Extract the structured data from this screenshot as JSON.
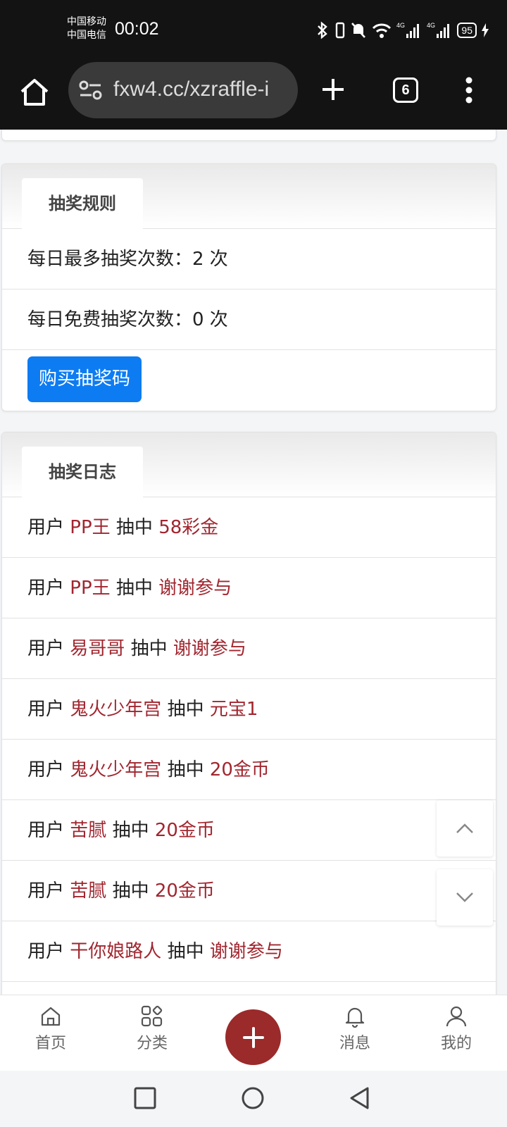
{
  "status_bar": {
    "carrier_1": "中国移动",
    "carrier_2": "中国电信",
    "time": "00:02",
    "network_1": "4G",
    "network_2": "4G",
    "battery": "95"
  },
  "browser": {
    "url": "fxw4.cc/xzraffle-i",
    "tab_count": "6"
  },
  "rules_card": {
    "title": "抽奖规则",
    "max_daily": "每日最多抽奖次数：2 次",
    "free_daily": "每日免费抽奖次数：0 次",
    "buy_button": "购买抽奖码"
  },
  "log_card": {
    "title": "抽奖日志",
    "prefix": "用户",
    "verb": "抽中",
    "entries": [
      {
        "user": "PP王",
        "prize": "58彩金"
      },
      {
        "user": "PP王",
        "prize": "谢谢参与"
      },
      {
        "user": "易哥哥",
        "prize": "谢谢参与"
      },
      {
        "user": "鬼火少年宫",
        "prize": "元宝1"
      },
      {
        "user": "鬼火少年宫",
        "prize": "20金币"
      },
      {
        "user": "苦腻",
        "prize": "20金币"
      },
      {
        "user": "苦腻",
        "prize": "20金币"
      },
      {
        "user": "干你娘路人",
        "prize": "谢谢参与"
      }
    ]
  },
  "bottom_nav": {
    "home": "首页",
    "category": "分类",
    "messages": "消息",
    "mine": "我的"
  },
  "colors": {
    "accent_red": "#a1262f",
    "fab_red": "#9b2a2a",
    "button_blue": "#0d7cf2"
  }
}
